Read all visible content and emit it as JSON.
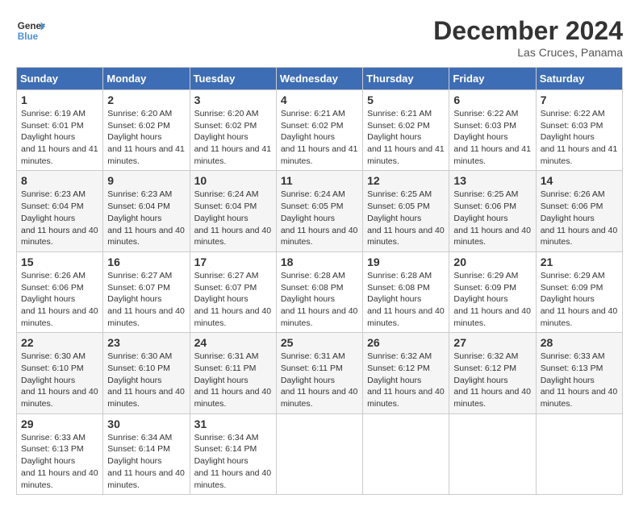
{
  "header": {
    "logo_line1": "General",
    "logo_line2": "Blue",
    "month_title": "December 2024",
    "location": "Las Cruces, Panama"
  },
  "weekdays": [
    "Sunday",
    "Monday",
    "Tuesday",
    "Wednesday",
    "Thursday",
    "Friday",
    "Saturday"
  ],
  "weeks": [
    [
      {
        "day": "1",
        "sunrise": "6:19 AM",
        "sunset": "6:01 PM",
        "daylight": "11 hours and 41 minutes."
      },
      {
        "day": "2",
        "sunrise": "6:20 AM",
        "sunset": "6:02 PM",
        "daylight": "11 hours and 41 minutes."
      },
      {
        "day": "3",
        "sunrise": "6:20 AM",
        "sunset": "6:02 PM",
        "daylight": "11 hours and 41 minutes."
      },
      {
        "day": "4",
        "sunrise": "6:21 AM",
        "sunset": "6:02 PM",
        "daylight": "11 hours and 41 minutes."
      },
      {
        "day": "5",
        "sunrise": "6:21 AM",
        "sunset": "6:02 PM",
        "daylight": "11 hours and 41 minutes."
      },
      {
        "day": "6",
        "sunrise": "6:22 AM",
        "sunset": "6:03 PM",
        "daylight": "11 hours and 41 minutes."
      },
      {
        "day": "7",
        "sunrise": "6:22 AM",
        "sunset": "6:03 PM",
        "daylight": "11 hours and 41 minutes."
      }
    ],
    [
      {
        "day": "8",
        "sunrise": "6:23 AM",
        "sunset": "6:04 PM",
        "daylight": "11 hours and 40 minutes."
      },
      {
        "day": "9",
        "sunrise": "6:23 AM",
        "sunset": "6:04 PM",
        "daylight": "11 hours and 40 minutes."
      },
      {
        "day": "10",
        "sunrise": "6:24 AM",
        "sunset": "6:04 PM",
        "daylight": "11 hours and 40 minutes."
      },
      {
        "day": "11",
        "sunrise": "6:24 AM",
        "sunset": "6:05 PM",
        "daylight": "11 hours and 40 minutes."
      },
      {
        "day": "12",
        "sunrise": "6:25 AM",
        "sunset": "6:05 PM",
        "daylight": "11 hours and 40 minutes."
      },
      {
        "day": "13",
        "sunrise": "6:25 AM",
        "sunset": "6:06 PM",
        "daylight": "11 hours and 40 minutes."
      },
      {
        "day": "14",
        "sunrise": "6:26 AM",
        "sunset": "6:06 PM",
        "daylight": "11 hours and 40 minutes."
      }
    ],
    [
      {
        "day": "15",
        "sunrise": "6:26 AM",
        "sunset": "6:06 PM",
        "daylight": "11 hours and 40 minutes."
      },
      {
        "day": "16",
        "sunrise": "6:27 AM",
        "sunset": "6:07 PM",
        "daylight": "11 hours and 40 minutes."
      },
      {
        "day": "17",
        "sunrise": "6:27 AM",
        "sunset": "6:07 PM",
        "daylight": "11 hours and 40 minutes."
      },
      {
        "day": "18",
        "sunrise": "6:28 AM",
        "sunset": "6:08 PM",
        "daylight": "11 hours and 40 minutes."
      },
      {
        "day": "19",
        "sunrise": "6:28 AM",
        "sunset": "6:08 PM",
        "daylight": "11 hours and 40 minutes."
      },
      {
        "day": "20",
        "sunrise": "6:29 AM",
        "sunset": "6:09 PM",
        "daylight": "11 hours and 40 minutes."
      },
      {
        "day": "21",
        "sunrise": "6:29 AM",
        "sunset": "6:09 PM",
        "daylight": "11 hours and 40 minutes."
      }
    ],
    [
      {
        "day": "22",
        "sunrise": "6:30 AM",
        "sunset": "6:10 PM",
        "daylight": "11 hours and 40 minutes."
      },
      {
        "day": "23",
        "sunrise": "6:30 AM",
        "sunset": "6:10 PM",
        "daylight": "11 hours and 40 minutes."
      },
      {
        "day": "24",
        "sunrise": "6:31 AM",
        "sunset": "6:11 PM",
        "daylight": "11 hours and 40 minutes."
      },
      {
        "day": "25",
        "sunrise": "6:31 AM",
        "sunset": "6:11 PM",
        "daylight": "11 hours and 40 minutes."
      },
      {
        "day": "26",
        "sunrise": "6:32 AM",
        "sunset": "6:12 PM",
        "daylight": "11 hours and 40 minutes."
      },
      {
        "day": "27",
        "sunrise": "6:32 AM",
        "sunset": "6:12 PM",
        "daylight": "11 hours and 40 minutes."
      },
      {
        "day": "28",
        "sunrise": "6:33 AM",
        "sunset": "6:13 PM",
        "daylight": "11 hours and 40 minutes."
      }
    ],
    [
      {
        "day": "29",
        "sunrise": "6:33 AM",
        "sunset": "6:13 PM",
        "daylight": "11 hours and 40 minutes."
      },
      {
        "day": "30",
        "sunrise": "6:34 AM",
        "sunset": "6:14 PM",
        "daylight": "11 hours and 40 minutes."
      },
      {
        "day": "31",
        "sunrise": "6:34 AM",
        "sunset": "6:14 PM",
        "daylight": "11 hours and 40 minutes."
      },
      null,
      null,
      null,
      null
    ]
  ]
}
